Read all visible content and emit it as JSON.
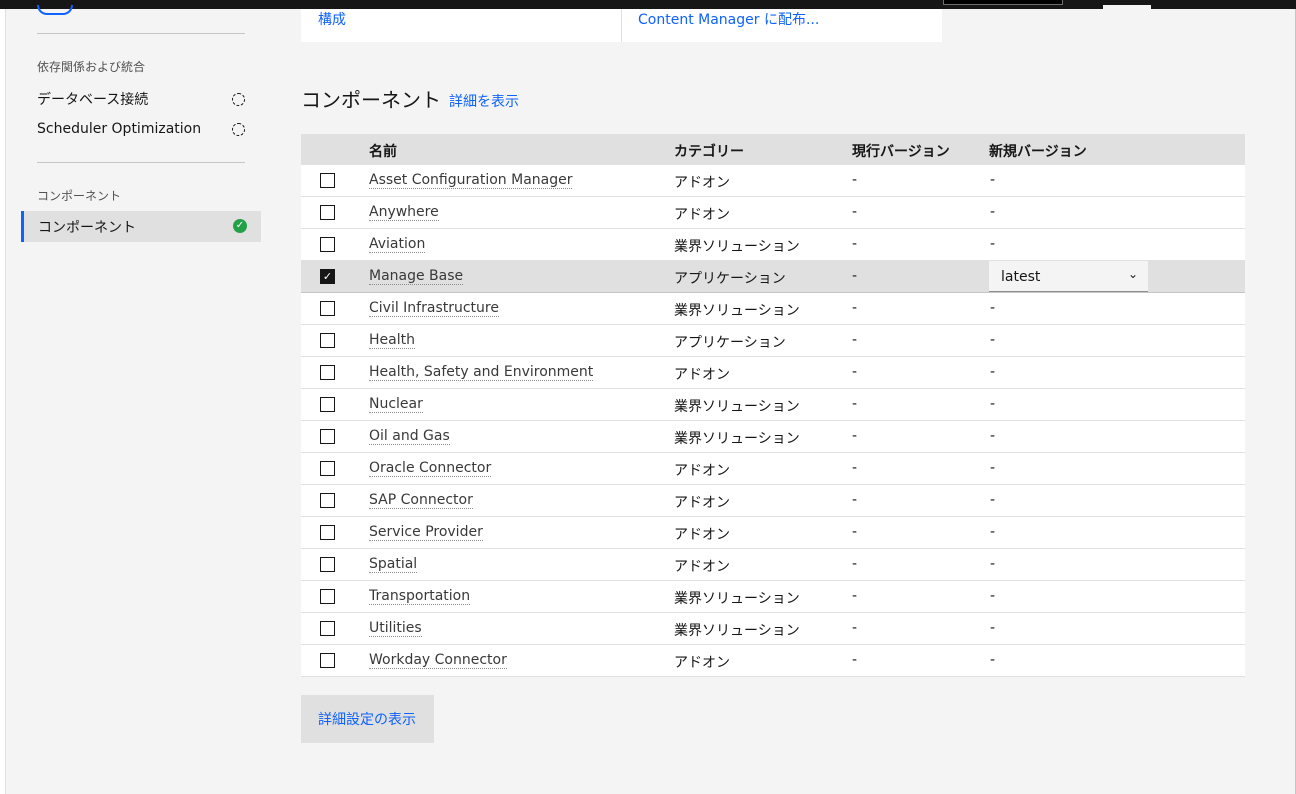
{
  "top_card": {
    "left_link": "構成",
    "right_link": "Content Manager に配布..."
  },
  "sidebar": {
    "group1_heading": "依存関係および統合",
    "group1_items": [
      {
        "label": "データベース接続"
      },
      {
        "label": "Scheduler Optimization"
      }
    ],
    "group2_heading": "コンポーネント",
    "active_item": {
      "label": "コンポーネント"
    }
  },
  "section": {
    "title": "コンポーネント",
    "details_link": "詳細を表示"
  },
  "table": {
    "headers": {
      "name": "名前",
      "category": "カテゴリー",
      "current_version": "現行バージョン",
      "new_version": "新規バージョン"
    },
    "rows": [
      {
        "name": "Asset Configuration Manager",
        "category": "アドオン",
        "current": "-",
        "new": "-",
        "checked": false
      },
      {
        "name": "Anywhere",
        "category": "アドオン",
        "current": "-",
        "new": "-",
        "checked": false
      },
      {
        "name": "Aviation",
        "category": "業界ソリューション",
        "current": "-",
        "new": "-",
        "checked": false
      },
      {
        "name": "Manage Base",
        "category": "アプリケーション",
        "current": "-",
        "new": "latest",
        "checked": true
      },
      {
        "name": "Civil Infrastructure",
        "category": "業界ソリューション",
        "current": "-",
        "new": "-",
        "checked": false
      },
      {
        "name": "Health",
        "category": "アプリケーション",
        "current": "-",
        "new": "-",
        "checked": false
      },
      {
        "name": "Health, Safety and Environment",
        "category": "アドオン",
        "current": "-",
        "new": "-",
        "checked": false
      },
      {
        "name": "Nuclear",
        "category": "業界ソリューション",
        "current": "-",
        "new": "-",
        "checked": false
      },
      {
        "name": "Oil and Gas",
        "category": "業界ソリューション",
        "current": "-",
        "new": "-",
        "checked": false
      },
      {
        "name": "Oracle Connector",
        "category": "アドオン",
        "current": "-",
        "new": "-",
        "checked": false
      },
      {
        "name": "SAP Connector",
        "category": "アドオン",
        "current": "-",
        "new": "-",
        "checked": false
      },
      {
        "name": "Service Provider",
        "category": "アドオン",
        "current": "-",
        "new": "-",
        "checked": false
      },
      {
        "name": "Spatial",
        "category": "アドオン",
        "current": "-",
        "new": "-",
        "checked": false
      },
      {
        "name": "Transportation",
        "category": "業界ソリューション",
        "current": "-",
        "new": "-",
        "checked": false
      },
      {
        "name": "Utilities",
        "category": "業界ソリューション",
        "current": "-",
        "new": "-",
        "checked": false
      },
      {
        "name": "Workday Connector",
        "category": "アドオン",
        "current": "-",
        "new": "-",
        "checked": false
      }
    ]
  },
  "advanced_button": "詳細設定の表示",
  "icons": {
    "pending": "dashed-circle-icon",
    "complete": "checkmark-filled-icon",
    "dropdown": "chevron-down-icon",
    "checkbox_checked": "checkmark-icon"
  },
  "colors": {
    "accent": "#0f62fe",
    "success": "#24a148",
    "background": "#f4f4f4",
    "selected_row": "#e0e0e0"
  }
}
